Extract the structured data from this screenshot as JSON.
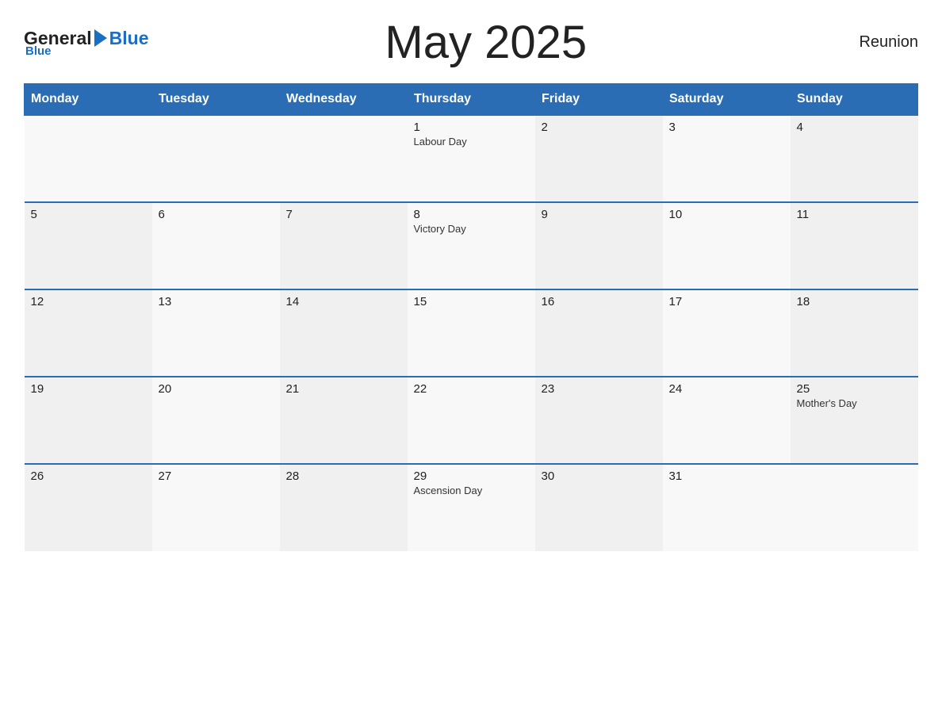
{
  "header": {
    "title": "May 2025",
    "region": "Reunion",
    "logo": {
      "general": "General",
      "blue": "Blue"
    }
  },
  "weekdays": [
    "Monday",
    "Tuesday",
    "Wednesday",
    "Thursday",
    "Friday",
    "Saturday",
    "Sunday"
  ],
  "weeks": [
    [
      {
        "day": "",
        "event": ""
      },
      {
        "day": "",
        "event": ""
      },
      {
        "day": "",
        "event": ""
      },
      {
        "day": "1",
        "event": "Labour Day"
      },
      {
        "day": "2",
        "event": ""
      },
      {
        "day": "3",
        "event": ""
      },
      {
        "day": "4",
        "event": ""
      }
    ],
    [
      {
        "day": "5",
        "event": ""
      },
      {
        "day": "6",
        "event": ""
      },
      {
        "day": "7",
        "event": ""
      },
      {
        "day": "8",
        "event": "Victory Day"
      },
      {
        "day": "9",
        "event": ""
      },
      {
        "day": "10",
        "event": ""
      },
      {
        "day": "11",
        "event": ""
      }
    ],
    [
      {
        "day": "12",
        "event": ""
      },
      {
        "day": "13",
        "event": ""
      },
      {
        "day": "14",
        "event": ""
      },
      {
        "day": "15",
        "event": ""
      },
      {
        "day": "16",
        "event": ""
      },
      {
        "day": "17",
        "event": ""
      },
      {
        "day": "18",
        "event": ""
      }
    ],
    [
      {
        "day": "19",
        "event": ""
      },
      {
        "day": "20",
        "event": ""
      },
      {
        "day": "21",
        "event": ""
      },
      {
        "day": "22",
        "event": ""
      },
      {
        "day": "23",
        "event": ""
      },
      {
        "day": "24",
        "event": ""
      },
      {
        "day": "25",
        "event": "Mother's Day"
      }
    ],
    [
      {
        "day": "26",
        "event": ""
      },
      {
        "day": "27",
        "event": ""
      },
      {
        "day": "28",
        "event": ""
      },
      {
        "day": "29",
        "event": "Ascension Day"
      },
      {
        "day": "30",
        "event": ""
      },
      {
        "day": "31",
        "event": ""
      },
      {
        "day": "",
        "event": ""
      }
    ]
  ]
}
